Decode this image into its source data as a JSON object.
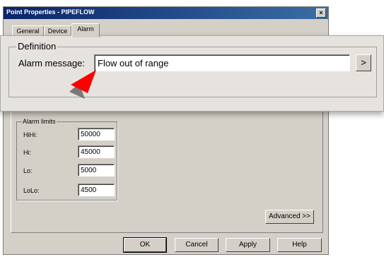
{
  "dialog": {
    "title": "Point Properties - PIPEFLOW",
    "close_glyph": "×"
  },
  "tabs": [
    {
      "label": "General"
    },
    {
      "label": "Device"
    },
    {
      "label": "Alarm",
      "active": true
    }
  ],
  "definition": {
    "legend": "Definition",
    "alarm_label": "Alarm message:",
    "alarm_value": "Flow out of range",
    "browse_glyph": ">"
  },
  "alarm_limits": {
    "legend": "Alarm limits",
    "rows": [
      {
        "label": "HiHi:",
        "value": "50000"
      },
      {
        "label": "Hi:",
        "value": "45000"
      },
      {
        "label": "Lo:",
        "value": "5000"
      },
      {
        "label": "LoLo:",
        "value": "4500"
      }
    ]
  },
  "buttons": {
    "advanced": "Advanced >>",
    "ok": "OK",
    "cancel": "Cancel",
    "apply": "Apply",
    "help": "Help"
  },
  "colors": {
    "dialog_face": "#d4d0c8",
    "title_bar": "#0a246a",
    "pointer": "#ff0000"
  }
}
